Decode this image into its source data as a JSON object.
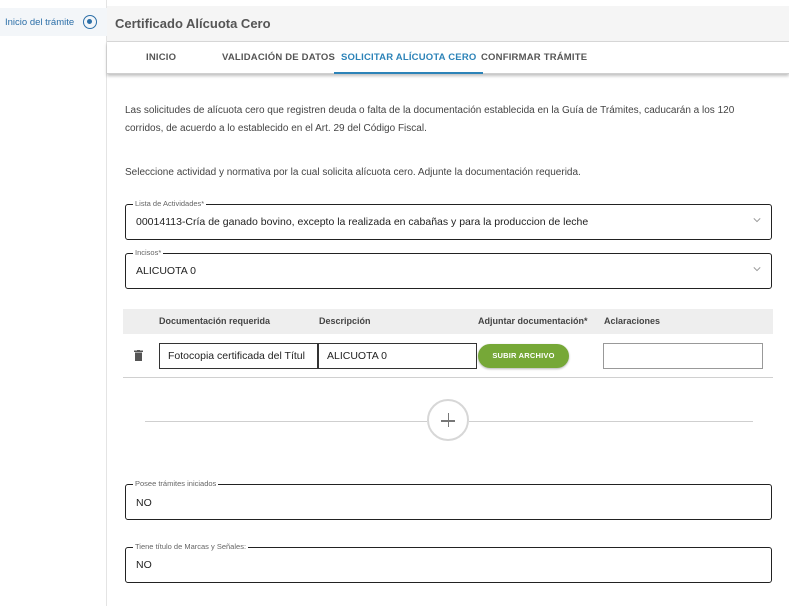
{
  "sidebar": {
    "home_label": "Inicio del trámite"
  },
  "header": {
    "title": "Certificado Alícuota Cero"
  },
  "tabs": [
    {
      "label": "INICIO",
      "active": false
    },
    {
      "label": "VALIDACIÓN DE DATOS",
      "active": false
    },
    {
      "label": "SOLICITAR ALÍCUOTA CERO",
      "active": true
    },
    {
      "label": "CONFIRMAR TRÁMITE",
      "active": false
    }
  ],
  "intro": {
    "line1": "Las solicitudes de alícuota cero que registren deuda o falta de la documentación establecida en la Guía de Trámites, caducarán a los 120",
    "line2": "corridos, de acuerdo a lo establecido en el Art. 29 del Código Fiscal.",
    "instruction": "Seleccione actividad y normativa por la cual solicita alícuota cero. Adjunte la documentación requerida."
  },
  "activities": {
    "label": "Lista de Actividades*",
    "value": "00014113-Cría de ganado bovino, excepto la realizada en cabañas y para la produccion de leche"
  },
  "incisos": {
    "label": "Incisos*",
    "value": "ALICUOTA 0"
  },
  "doc_table": {
    "headers": [
      "Documentación requerida",
      "Descripción",
      "Adjuntar documentación*",
      "Aclaraciones"
    ],
    "rows": [
      {
        "documentacion": "Fotocopia certificada del Títul",
        "descripcion": "ALICUOTA 0",
        "upload_label": "SUBIR ARCHIVO",
        "aclaraciones": ""
      }
    ]
  },
  "tramites_iniciados": {
    "label": "Posee trámites iniciados",
    "value": "NO"
  },
  "marcas_senales": {
    "label": "Tiene título de Marcas y Señales:",
    "value": "NO"
  },
  "colors": {
    "accent": "#2c83b8",
    "upload_button": "#76a837"
  },
  "icons": [
    "radio-circle-icon",
    "chevron-down-icon",
    "trash-icon",
    "plus-icon"
  ]
}
